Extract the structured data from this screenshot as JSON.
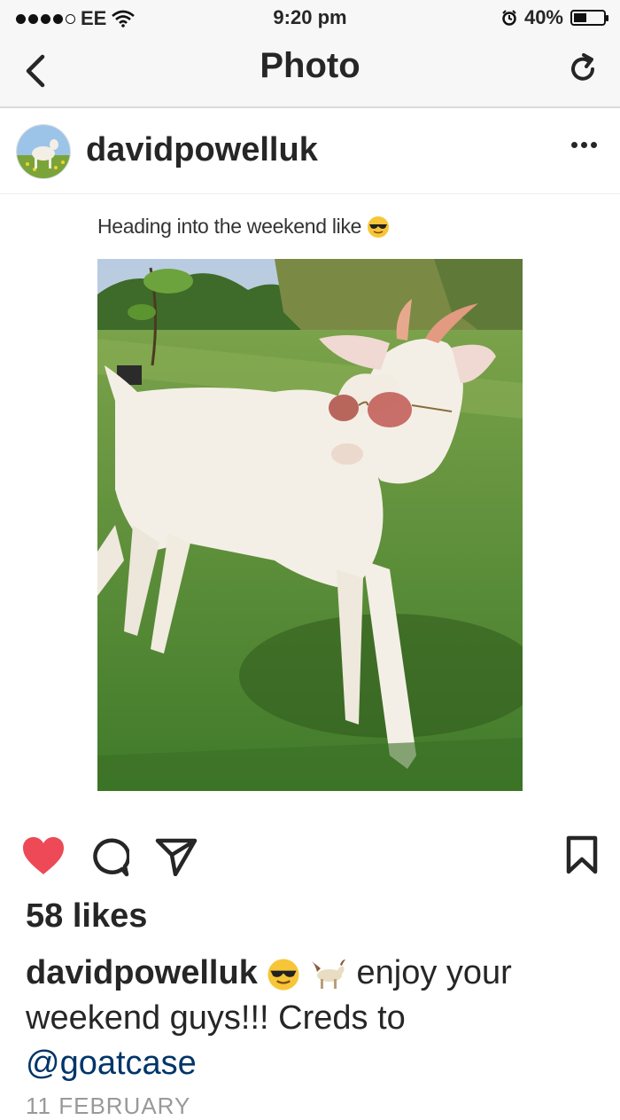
{
  "status_bar": {
    "carrier": "EE",
    "time": "9:20 pm",
    "battery_percent": "40%",
    "battery_level": 0.4,
    "signal_bars": 4
  },
  "nav": {
    "title": "Photo",
    "back_icon": "chevron-left-icon",
    "refresh_icon": "refresh-icon"
  },
  "post": {
    "username": "davidpowelluk",
    "image_caption": "Heading into the weekend like",
    "likes": "58 likes",
    "caption_user": "davidpowelluk",
    "caption_text_1": "enjoy your weekend guys!!! Creds to",
    "caption_mention": "@goatcase",
    "date": "11 FEBRUARY",
    "liked": true
  },
  "colors": {
    "heart": "#ed4956",
    "mention": "#003569",
    "text": "#262626",
    "bar_bg": "#f7f7f7"
  }
}
